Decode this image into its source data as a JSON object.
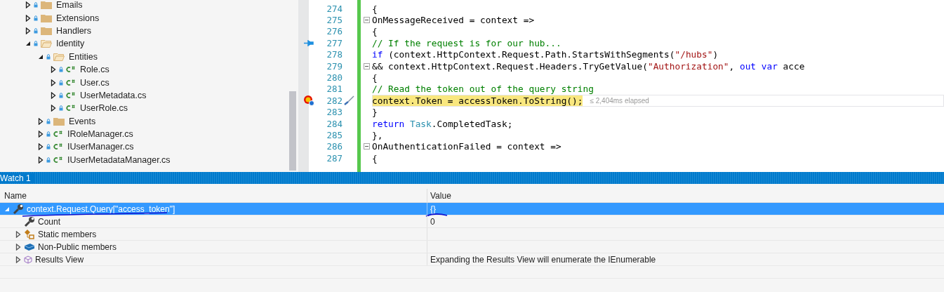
{
  "solution_explorer": {
    "items": [
      {
        "name": "Emails",
        "kind": "folder",
        "expanded": false
      },
      {
        "name": "Extensions",
        "kind": "folder",
        "expanded": false
      },
      {
        "name": "Handlers",
        "kind": "folder",
        "expanded": false
      },
      {
        "name": "Identity",
        "kind": "folder",
        "expanded": true,
        "children": [
          {
            "name": "Entities",
            "kind": "folder",
            "expanded": true,
            "children": [
              {
                "name": "Role.cs",
                "kind": "csharp",
                "expanded": false
              },
              {
                "name": "User.cs",
                "kind": "csharp",
                "expanded": false
              },
              {
                "name": "UserMetadata.cs",
                "kind": "csharp",
                "expanded": false
              },
              {
                "name": "UserRole.cs",
                "kind": "csharp",
                "expanded": false
              }
            ]
          },
          {
            "name": "Events",
            "kind": "folder",
            "expanded": false
          },
          {
            "name": "IRoleManager.cs",
            "kind": "csharp",
            "expanded": false
          },
          {
            "name": "IUserManager.cs",
            "kind": "csharp",
            "expanded": false
          },
          {
            "name": "IUserMetadataManager.cs",
            "kind": "csharp",
            "expanded": false
          }
        ]
      }
    ]
  },
  "editor": {
    "changed": true,
    "lines": [
      {
        "number": "274",
        "tokens": [
          {
            "kind": "plain",
            "text": "                {"
          }
        ]
      },
      {
        "number": "275",
        "fold": true,
        "tokens": [
          {
            "kind": "plain",
            "text": "                    OnMessageReceived = context =>"
          }
        ]
      },
      {
        "number": "276",
        "tokens": [
          {
            "kind": "plain",
            "text": "                    {"
          }
        ]
      },
      {
        "number": "277",
        "pinned": true,
        "tokens": [
          {
            "kind": "comment",
            "text": "                        // If the request is for our hub..."
          }
        ]
      },
      {
        "number": "278",
        "tokens": [
          {
            "kind": "keyword",
            "text": "                        if"
          },
          {
            "kind": "plain",
            "text": " (context.HttpContext.Request.Path.StartsWithSegments("
          },
          {
            "kind": "string",
            "text": "\"/hubs\""
          },
          {
            "kind": "plain",
            "text": ")"
          }
        ]
      },
      {
        "number": "279",
        "fold": true,
        "tokens": [
          {
            "kind": "plain",
            "text": "                            && context.HttpContext.Request.Headers.TryGetValue("
          },
          {
            "kind": "string",
            "text": "\"Authorization\""
          },
          {
            "kind": "plain",
            "text": ", "
          },
          {
            "kind": "keyword",
            "text": "out var"
          },
          {
            "kind": "plain",
            "text": " acce"
          }
        ]
      },
      {
        "number": "280",
        "tokens": [
          {
            "kind": "plain",
            "text": "                        {"
          }
        ]
      },
      {
        "number": "281",
        "tokens": [
          {
            "kind": "comment",
            "text": "                            // Read the token out of the query string"
          }
        ]
      },
      {
        "number": "282",
        "current": true,
        "tracepoint": true,
        "brush": true,
        "perf_tip": "≤ 2,404ms elapsed",
        "tokens": [
          {
            "kind": "plain",
            "text": "                            context.Token = accessToken.ToString();"
          }
        ]
      },
      {
        "number": "283",
        "tokens": [
          {
            "kind": "plain",
            "text": "                        }"
          }
        ]
      },
      {
        "number": "284",
        "tokens": [
          {
            "kind": "keyword",
            "text": "                        return"
          },
          {
            "kind": "type",
            "text": " Task"
          },
          {
            "kind": "plain",
            "text": ".CompletedTask;"
          }
        ]
      },
      {
        "number": "285",
        "tokens": [
          {
            "kind": "plain",
            "text": "                    },"
          }
        ]
      },
      {
        "number": "286",
        "fold": true,
        "tokens": [
          {
            "kind": "plain",
            "text": "                    OnAuthenticationFailed = context =>"
          }
        ]
      },
      {
        "number": "287",
        "tokens": [
          {
            "kind": "plain",
            "text": "                    {"
          }
        ]
      }
    ]
  },
  "watch": {
    "title": "Watch 1",
    "columns": [
      "Name",
      "Value"
    ],
    "rows": [
      {
        "name": "context.Request.Query[\"access_token\"]",
        "value": "{}",
        "kind": "property",
        "expanded": true,
        "selected": true,
        "children": [
          {
            "name": "Count",
            "value": "0",
            "kind": "property",
            "selected": false
          },
          {
            "name": "Static members",
            "kind": "static",
            "expanded": false,
            "selected": false
          },
          {
            "name": "Non-Public members",
            "kind": "nonpublic",
            "expanded": false,
            "selected": false
          },
          {
            "name": "Results View",
            "value": "Expanding the Results View will enumerate the IEnumerable",
            "kind": "results",
            "expanded": false,
            "selected": false
          }
        ]
      }
    ]
  }
}
